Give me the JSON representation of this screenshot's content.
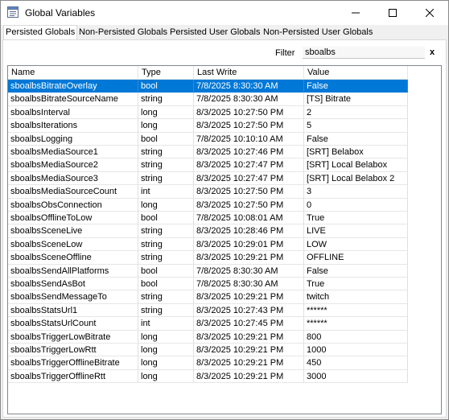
{
  "window": {
    "title": "Global Variables",
    "icon": "app-window-icon"
  },
  "tabs": [
    {
      "label": "Persisted Globals",
      "active": true
    },
    {
      "label": "Non-Persisted Globals",
      "active": false
    },
    {
      "label": "Persisted User Globals",
      "active": false
    },
    {
      "label": "Non-Persisted User Globals",
      "active": false
    }
  ],
  "filter": {
    "label": "Filter",
    "value": "sboalbs",
    "clear_label": "x"
  },
  "columns": [
    "Name",
    "Type",
    "Last Write",
    "Value"
  ],
  "rows": [
    [
      "sboalbsBitrateOverlay",
      "bool",
      "7/8/2025 8:30:30 AM",
      "False"
    ],
    [
      "sboalbsBitrateSourceName",
      "string",
      "7/8/2025 8:30:30 AM",
      "[TS] Bitrate"
    ],
    [
      "sboalbsInterval",
      "long",
      "8/3/2025 10:27:50 PM",
      "2"
    ],
    [
      "sboalbsIterations",
      "long",
      "8/3/2025 10:27:50 PM",
      "5"
    ],
    [
      "sboalbsLogging",
      "bool",
      "7/8/2025 10:10:10 AM",
      "False"
    ],
    [
      "sboalbsMediaSource1",
      "string",
      "8/3/2025 10:27:46 PM",
      "[SRT] Belabox"
    ],
    [
      "sboalbsMediaSource2",
      "string",
      "8/3/2025 10:27:47 PM",
      "[SRT] Local Belabox"
    ],
    [
      "sboalbsMediaSource3",
      "string",
      "8/3/2025 10:27:47 PM",
      "[SRT] Local Belabox 2"
    ],
    [
      "sboalbsMediaSourceCount",
      "int",
      "8/3/2025 10:27:50 PM",
      "3"
    ],
    [
      "sboalbsObsConnection",
      "long",
      "8/3/2025 10:27:50 PM",
      "0"
    ],
    [
      "sboalbsOfflineToLow",
      "bool",
      "7/8/2025 10:08:01 AM",
      "True"
    ],
    [
      "sboalbsSceneLive",
      "string",
      "8/3/2025 10:28:46 PM",
      "LIVE"
    ],
    [
      "sboalbsSceneLow",
      "string",
      "8/3/2025 10:29:01 PM",
      "LOW"
    ],
    [
      "sboalbsSceneOffline",
      "string",
      "8/3/2025 10:29:21 PM",
      "OFFLINE"
    ],
    [
      "sboalbsSendAllPlatforms",
      "bool",
      "7/8/2025 8:30:30 AM",
      "False"
    ],
    [
      "sboalbsSendAsBot",
      "bool",
      "7/8/2025 8:30:30 AM",
      "True"
    ],
    [
      "sboalbsSendMessageTo",
      "string",
      "8/3/2025 10:29:21 PM",
      "twitch"
    ],
    [
      "sboalbsStatsUrl1",
      "string",
      "8/3/2025 10:27:43 PM",
      "******"
    ],
    [
      "sboalbsStatsUrlCount",
      "int",
      "8/3/2025 10:27:45 PM",
      "******"
    ],
    [
      "sboalbsTriggerLowBitrate",
      "long",
      "8/3/2025 10:29:21 PM",
      "800"
    ],
    [
      "sboalbsTriggerLowRtt",
      "long",
      "8/3/2025 10:29:21 PM",
      "1000"
    ],
    [
      "sboalbsTriggerOfflineBitrate",
      "long",
      "8/3/2025 10:29:21 PM",
      "450"
    ],
    [
      "sboalbsTriggerOfflineRtt",
      "long",
      "8/3/2025 10:29:21 PM",
      "3000"
    ]
  ],
  "selected_row": 0,
  "colors": {
    "selection": "#0078d7",
    "window_bg": "#f0f0f0"
  }
}
